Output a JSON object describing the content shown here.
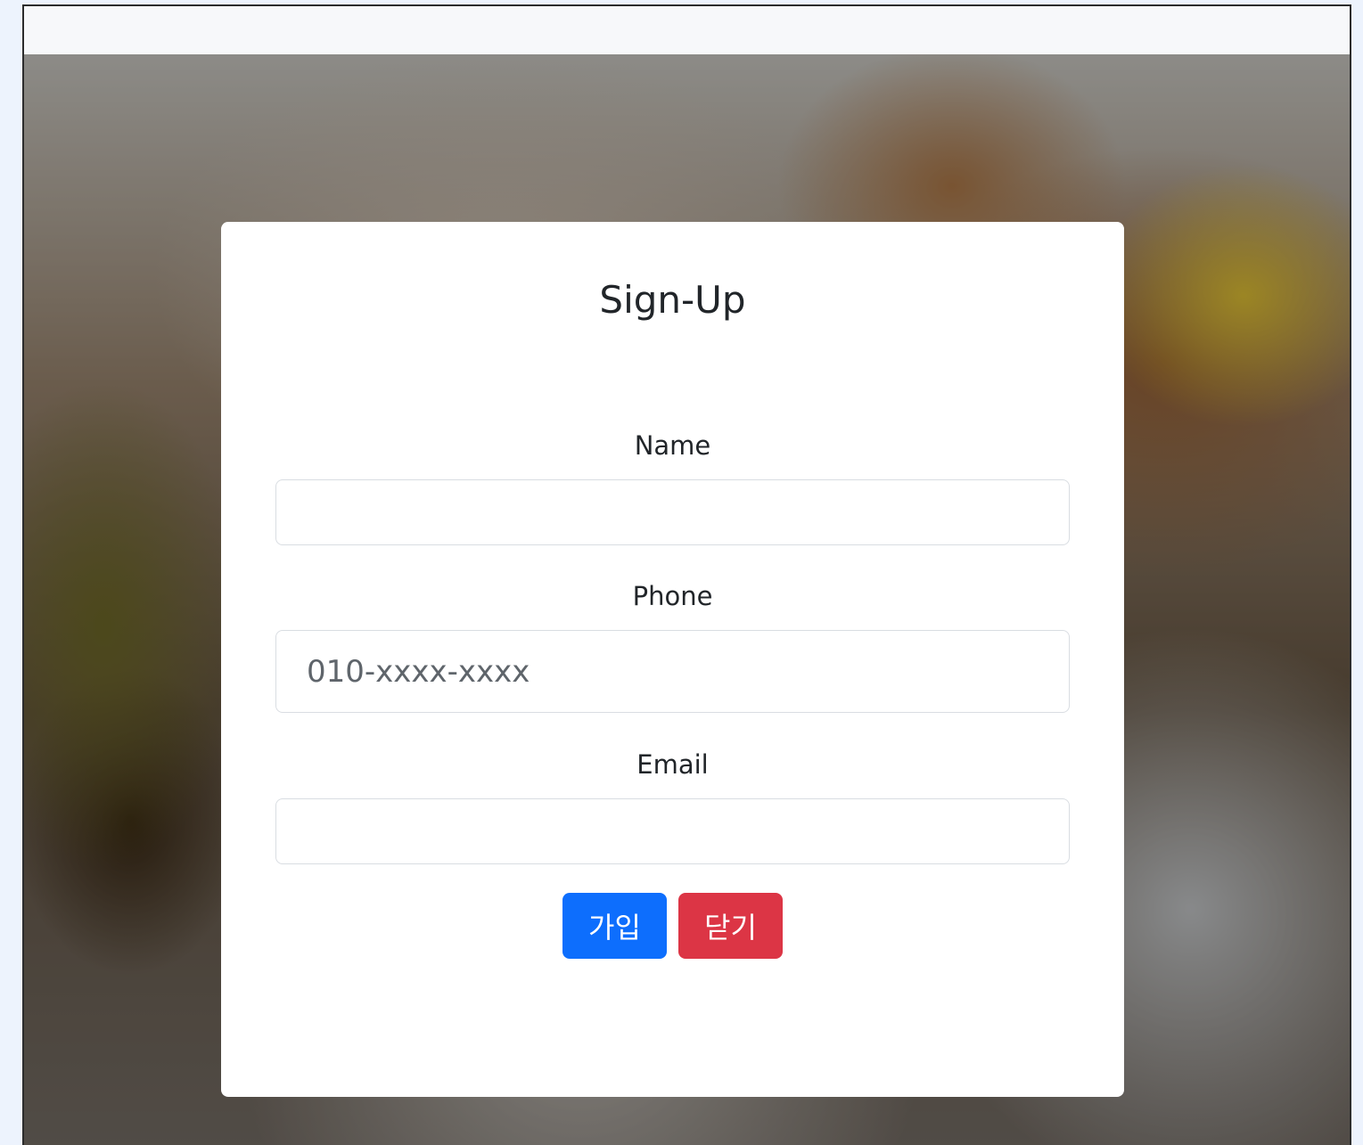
{
  "form": {
    "title": "Sign-Up",
    "name_label": "Name",
    "name_value": "",
    "phone_label": "Phone",
    "phone_placeholder": "010-xxxx-xxxx",
    "email_label": "Email",
    "email_value": "",
    "join_label": "가입",
    "close_label": "닫기"
  },
  "colors": {
    "primary": "#0d6efd",
    "danger": "#dc3545"
  }
}
